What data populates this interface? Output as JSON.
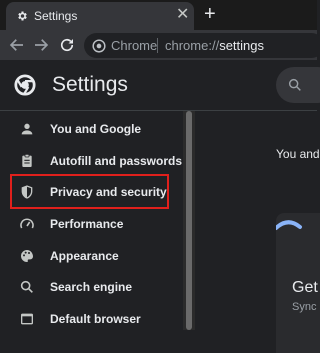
{
  "tab": {
    "title": "Settings",
    "close": "✕",
    "new_tab": "+"
  },
  "omnibox": {
    "site": "Chrome",
    "scheme": "chrome://",
    "path": "settings"
  },
  "header": {
    "title": "Settings"
  },
  "sidebar": {
    "items": [
      {
        "label": "You and Google",
        "icon": "person-icon"
      },
      {
        "label": "Autofill and passwords",
        "icon": "clipboard-icon"
      },
      {
        "label": "Privacy and security",
        "icon": "shield-icon",
        "highlighted": true
      },
      {
        "label": "Performance",
        "icon": "speedometer-icon"
      },
      {
        "label": "Appearance",
        "icon": "palette-icon"
      },
      {
        "label": "Search engine",
        "icon": "search-icon"
      },
      {
        "label": "Default browser",
        "icon": "browser-icon"
      }
    ]
  },
  "main": {
    "intro_text": "You and",
    "card_title": "Get",
    "card_subtitle": "Sync a"
  },
  "colors": {
    "highlight_border": "#e0201c",
    "background": "#202124",
    "accent": "#8ab4f8"
  }
}
